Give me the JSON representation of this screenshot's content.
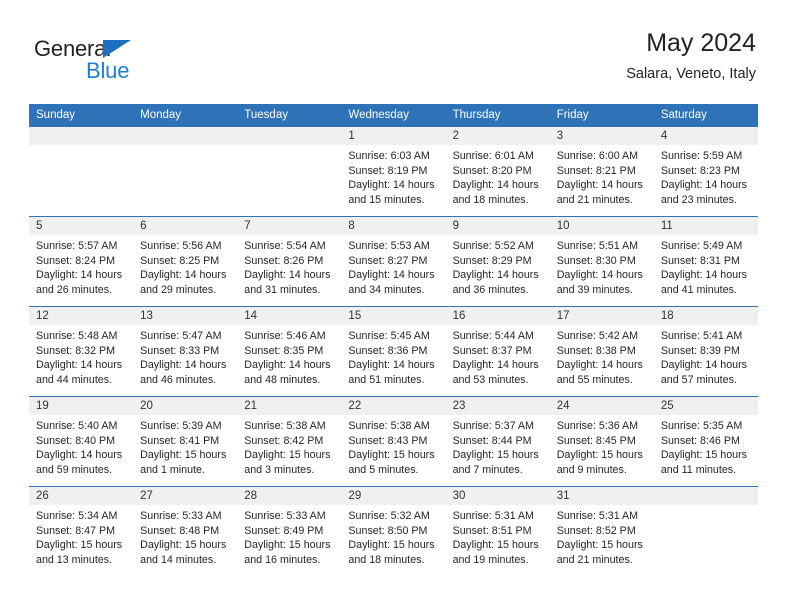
{
  "brand": {
    "name_part1": "General",
    "name_part2": "Blue"
  },
  "header": {
    "title": "May 2024",
    "subtitle": "Salara, Veneto, Italy"
  },
  "colors": {
    "header_blue": "#2e72b8",
    "logo_blue": "#1f7fd4",
    "daynum_bg": "#f0f0f0"
  },
  "weekdays": [
    "Sunday",
    "Monday",
    "Tuesday",
    "Wednesday",
    "Thursday",
    "Friday",
    "Saturday"
  ],
  "weeks": [
    [
      {
        "day": "",
        "empty": true
      },
      {
        "day": "",
        "empty": true
      },
      {
        "day": "",
        "empty": true
      },
      {
        "day": "1",
        "sunrise": "Sunrise: 6:03 AM",
        "sunset": "Sunset: 8:19 PM",
        "daylight_1": "Daylight: 14 hours",
        "daylight_2": "and 15 minutes."
      },
      {
        "day": "2",
        "sunrise": "Sunrise: 6:01 AM",
        "sunset": "Sunset: 8:20 PM",
        "daylight_1": "Daylight: 14 hours",
        "daylight_2": "and 18 minutes."
      },
      {
        "day": "3",
        "sunrise": "Sunrise: 6:00 AM",
        "sunset": "Sunset: 8:21 PM",
        "daylight_1": "Daylight: 14 hours",
        "daylight_2": "and 21 minutes."
      },
      {
        "day": "4",
        "sunrise": "Sunrise: 5:59 AM",
        "sunset": "Sunset: 8:23 PM",
        "daylight_1": "Daylight: 14 hours",
        "daylight_2": "and 23 minutes."
      }
    ],
    [
      {
        "day": "5",
        "sunrise": "Sunrise: 5:57 AM",
        "sunset": "Sunset: 8:24 PM",
        "daylight_1": "Daylight: 14 hours",
        "daylight_2": "and 26 minutes."
      },
      {
        "day": "6",
        "sunrise": "Sunrise: 5:56 AM",
        "sunset": "Sunset: 8:25 PM",
        "daylight_1": "Daylight: 14 hours",
        "daylight_2": "and 29 minutes."
      },
      {
        "day": "7",
        "sunrise": "Sunrise: 5:54 AM",
        "sunset": "Sunset: 8:26 PM",
        "daylight_1": "Daylight: 14 hours",
        "daylight_2": "and 31 minutes."
      },
      {
        "day": "8",
        "sunrise": "Sunrise: 5:53 AM",
        "sunset": "Sunset: 8:27 PM",
        "daylight_1": "Daylight: 14 hours",
        "daylight_2": "and 34 minutes."
      },
      {
        "day": "9",
        "sunrise": "Sunrise: 5:52 AM",
        "sunset": "Sunset: 8:29 PM",
        "daylight_1": "Daylight: 14 hours",
        "daylight_2": "and 36 minutes."
      },
      {
        "day": "10",
        "sunrise": "Sunrise: 5:51 AM",
        "sunset": "Sunset: 8:30 PM",
        "daylight_1": "Daylight: 14 hours",
        "daylight_2": "and 39 minutes."
      },
      {
        "day": "11",
        "sunrise": "Sunrise: 5:49 AM",
        "sunset": "Sunset: 8:31 PM",
        "daylight_1": "Daylight: 14 hours",
        "daylight_2": "and 41 minutes."
      }
    ],
    [
      {
        "day": "12",
        "sunrise": "Sunrise: 5:48 AM",
        "sunset": "Sunset: 8:32 PM",
        "daylight_1": "Daylight: 14 hours",
        "daylight_2": "and 44 minutes."
      },
      {
        "day": "13",
        "sunrise": "Sunrise: 5:47 AM",
        "sunset": "Sunset: 8:33 PM",
        "daylight_1": "Daylight: 14 hours",
        "daylight_2": "and 46 minutes."
      },
      {
        "day": "14",
        "sunrise": "Sunrise: 5:46 AM",
        "sunset": "Sunset: 8:35 PM",
        "daylight_1": "Daylight: 14 hours",
        "daylight_2": "and 48 minutes."
      },
      {
        "day": "15",
        "sunrise": "Sunrise: 5:45 AM",
        "sunset": "Sunset: 8:36 PM",
        "daylight_1": "Daylight: 14 hours",
        "daylight_2": "and 51 minutes."
      },
      {
        "day": "16",
        "sunrise": "Sunrise: 5:44 AM",
        "sunset": "Sunset: 8:37 PM",
        "daylight_1": "Daylight: 14 hours",
        "daylight_2": "and 53 minutes."
      },
      {
        "day": "17",
        "sunrise": "Sunrise: 5:42 AM",
        "sunset": "Sunset: 8:38 PM",
        "daylight_1": "Daylight: 14 hours",
        "daylight_2": "and 55 minutes."
      },
      {
        "day": "18",
        "sunrise": "Sunrise: 5:41 AM",
        "sunset": "Sunset: 8:39 PM",
        "daylight_1": "Daylight: 14 hours",
        "daylight_2": "and 57 minutes."
      }
    ],
    [
      {
        "day": "19",
        "sunrise": "Sunrise: 5:40 AM",
        "sunset": "Sunset: 8:40 PM",
        "daylight_1": "Daylight: 14 hours",
        "daylight_2": "and 59 minutes."
      },
      {
        "day": "20",
        "sunrise": "Sunrise: 5:39 AM",
        "sunset": "Sunset: 8:41 PM",
        "daylight_1": "Daylight: 15 hours",
        "daylight_2": "and 1 minute."
      },
      {
        "day": "21",
        "sunrise": "Sunrise: 5:38 AM",
        "sunset": "Sunset: 8:42 PM",
        "daylight_1": "Daylight: 15 hours",
        "daylight_2": "and 3 minutes."
      },
      {
        "day": "22",
        "sunrise": "Sunrise: 5:38 AM",
        "sunset": "Sunset: 8:43 PM",
        "daylight_1": "Daylight: 15 hours",
        "daylight_2": "and 5 minutes."
      },
      {
        "day": "23",
        "sunrise": "Sunrise: 5:37 AM",
        "sunset": "Sunset: 8:44 PM",
        "daylight_1": "Daylight: 15 hours",
        "daylight_2": "and 7 minutes."
      },
      {
        "day": "24",
        "sunrise": "Sunrise: 5:36 AM",
        "sunset": "Sunset: 8:45 PM",
        "daylight_1": "Daylight: 15 hours",
        "daylight_2": "and 9 minutes."
      },
      {
        "day": "25",
        "sunrise": "Sunrise: 5:35 AM",
        "sunset": "Sunset: 8:46 PM",
        "daylight_1": "Daylight: 15 hours",
        "daylight_2": "and 11 minutes."
      }
    ],
    [
      {
        "day": "26",
        "sunrise": "Sunrise: 5:34 AM",
        "sunset": "Sunset: 8:47 PM",
        "daylight_1": "Daylight: 15 hours",
        "daylight_2": "and 13 minutes."
      },
      {
        "day": "27",
        "sunrise": "Sunrise: 5:33 AM",
        "sunset": "Sunset: 8:48 PM",
        "daylight_1": "Daylight: 15 hours",
        "daylight_2": "and 14 minutes."
      },
      {
        "day": "28",
        "sunrise": "Sunrise: 5:33 AM",
        "sunset": "Sunset: 8:49 PM",
        "daylight_1": "Daylight: 15 hours",
        "daylight_2": "and 16 minutes."
      },
      {
        "day": "29",
        "sunrise": "Sunrise: 5:32 AM",
        "sunset": "Sunset: 8:50 PM",
        "daylight_1": "Daylight: 15 hours",
        "daylight_2": "and 18 minutes."
      },
      {
        "day": "30",
        "sunrise": "Sunrise: 5:31 AM",
        "sunset": "Sunset: 8:51 PM",
        "daylight_1": "Daylight: 15 hours",
        "daylight_2": "and 19 minutes."
      },
      {
        "day": "31",
        "sunrise": "Sunrise: 5:31 AM",
        "sunset": "Sunset: 8:52 PM",
        "daylight_1": "Daylight: 15 hours",
        "daylight_2": "and 21 minutes."
      },
      {
        "day": "",
        "empty": true
      }
    ]
  ]
}
